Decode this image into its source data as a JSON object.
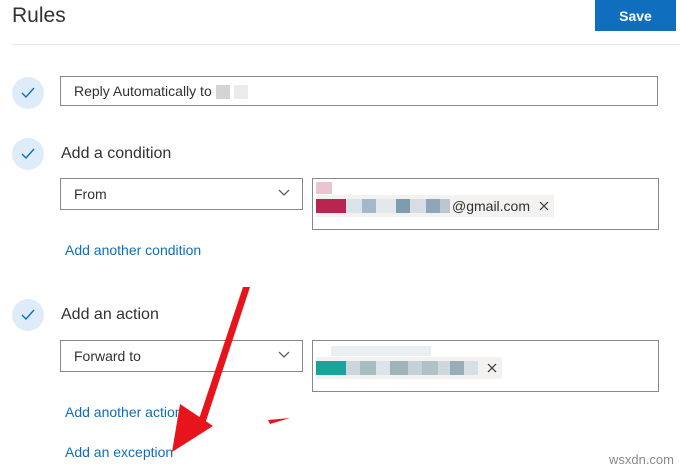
{
  "header": {
    "title": "Rules",
    "save_label": "Save"
  },
  "rule_name": {
    "value": "Reply Automatically to"
  },
  "condition": {
    "heading": "Add a condition",
    "select_value": "From",
    "recipient_suffix": "@gmail.com",
    "add_another_label": "Add another condition"
  },
  "action": {
    "heading": "Add an action",
    "select_value": "Forward to",
    "add_another_label": "Add another action"
  },
  "exception": {
    "label": "Add an exception"
  },
  "watermark": "wsxdn.com",
  "colors": {
    "accent": "#106ebe",
    "link": "#0f6cbd",
    "annotation_arrow": "#e8141b"
  }
}
